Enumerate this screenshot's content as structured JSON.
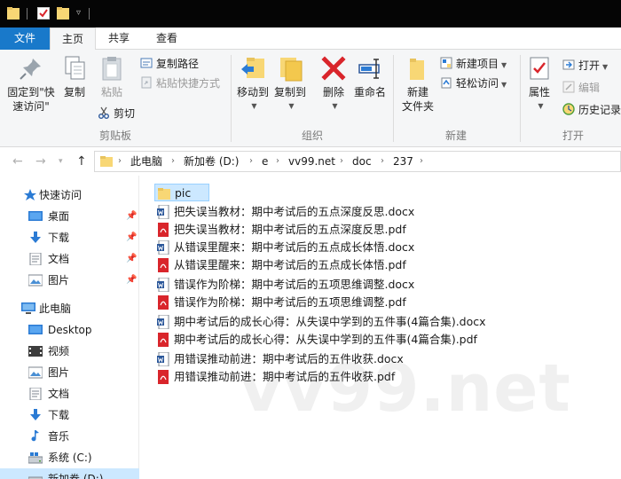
{
  "ribbon_tabs": {
    "file": "文件",
    "home": "主页",
    "share": "共享",
    "view": "查看"
  },
  "clipboard": {
    "pin_label_1": "固定到\"快",
    "pin_label_2": "速访问\"",
    "copy": "复制",
    "paste": "粘贴",
    "copy_path": "复制路径",
    "paste_shortcut": "粘贴快捷方式",
    "cut": "剪切",
    "group": "剪贴板"
  },
  "organize": {
    "move_to": "移动到",
    "copy_to": "复制到",
    "delete": "删除",
    "rename": "重命名",
    "group": "组织"
  },
  "new_group": {
    "new_folder_1": "新建",
    "new_folder_2": "文件夹",
    "new_item": "新建项目",
    "easy_access": "轻松访问",
    "group": "新建"
  },
  "open_group": {
    "properties": "属性",
    "open": "打开",
    "edit": "编辑",
    "history": "历史记录",
    "group": "打开"
  },
  "breadcrumb": [
    "此电脑",
    "新加卷 (D:)",
    "e",
    "vv99.net",
    "doc",
    "237"
  ],
  "nav_pane": {
    "quick_access": "快速访问",
    "quick_items": [
      "桌面",
      "下载",
      "文档",
      "图片"
    ],
    "this_pc": "此电脑",
    "pc_items": [
      "Desktop",
      "视频",
      "图片",
      "文档",
      "下载",
      "音乐",
      "系统 (C:)",
      "新加卷 (D:)"
    ]
  },
  "files": [
    {
      "name": "pic",
      "type": "folder"
    },
    {
      "name": "把失误当教材：期中考试后的五点深度反思.docx",
      "type": "docx"
    },
    {
      "name": "把失误当教材：期中考试后的五点深度反思.pdf",
      "type": "pdf"
    },
    {
      "name": "从错误里醒来：期中考试后的五点成长体悟.docx",
      "type": "docx"
    },
    {
      "name": "从错误里醒来：期中考试后的五点成长体悟.pdf",
      "type": "pdf"
    },
    {
      "name": "错误作为阶梯：期中考试后的五项思维调整.docx",
      "type": "docx"
    },
    {
      "name": "错误作为阶梯：期中考试后的五项思维调整.pdf",
      "type": "pdf"
    },
    {
      "name": "期中考试后的成长心得：从失误中学到的五件事(4篇合集).docx",
      "type": "docx"
    },
    {
      "name": "期中考试后的成长心得：从失误中学到的五件事(4篇合集).pdf",
      "type": "pdf"
    },
    {
      "name": "用错误推动前进：期中考试后的五件收获.docx",
      "type": "docx"
    },
    {
      "name": "用错误推动前进：期中考试后的五件收获.pdf",
      "type": "pdf"
    }
  ],
  "watermark": "vv99.net",
  "colors": {
    "accent": "#1979ca",
    "folder": "#f8d775",
    "pdf": "#d9252b",
    "docx": "#2b579a",
    "selection": "#cce8ff"
  }
}
